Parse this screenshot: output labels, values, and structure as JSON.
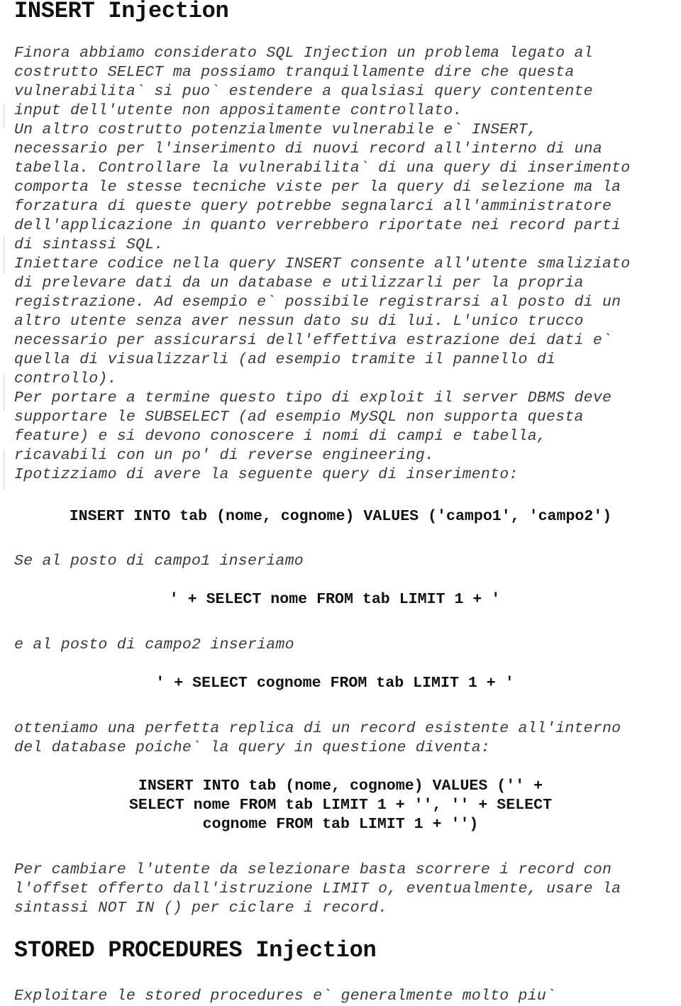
{
  "sections": [
    {
      "heading": "INSERT Injection",
      "paragraph1": [
        "Finora abbiamo considerato SQL Injection un problema legato al",
        "costrutto SELECT ma possiamo tranquillamente dire che questa",
        "vulnerabilita` si puo` estendere a qualsiasi query contentente",
        "input dell'utente non appositamente controllato.",
        "Un altro costrutto potenzialmente vulnerabile e` INSERT,",
        "necessario per l'inserimento di nuovi record all'interno di una",
        "tabella. Controllare la vulnerabilita` di una query di inserimento",
        "comporta le stesse tecniche viste per la query di selezione ma la",
        "forzatura di queste query potrebbe segnalarci all'amministratore",
        "dell'applicazione in quanto verrebbero riportate nei record parti",
        "di sintassi SQL.",
        "Iniettare codice nella query INSERT consente all'utente smaliziato",
        "di prelevare dati da un database e utilizzarli per la propria",
        "registrazione. Ad esempio e` possibile registrarsi al posto di un",
        "altro utente senza aver nessun dato su di lui. L'unico trucco",
        "necessario per assicurarsi dell'effettiva estrazione dei dati e`",
        "quella di visualizzarli (ad esempio tramite il pannello di",
        "controllo).",
        "Per portare a termine questo tipo di exploit il server DBMS deve",
        "supportare le SUBSELECT (ad esempio MySQL non supporta questa",
        "feature) e si devono conoscere i nomi di campi e tabella,",
        "ricavabili con un po' di reverse engineering.",
        "Ipotizziamo di avere la seguente query di inserimento:"
      ],
      "code1": "INSERT INTO tab (nome, cognome) VALUES ('campo1', 'campo2')",
      "text2": "Se al posto di campo1 inseriamo",
      "code2": "' + SELECT nome FROM tab LIMIT 1 + '",
      "text3": "e al posto di campo2 inseriamo",
      "code3": "' + SELECT cognome FROM tab LIMIT 1 + '",
      "paragraph4": [
        "otteniamo una perfetta replica di un record esistente all'interno",
        "del database poiche` la query in questione diventa:"
      ],
      "code4": [
        "INSERT INTO tab (nome, cognome) VALUES ('' +",
        "SELECT nome FROM tab LIMIT 1 + '', '' + SELECT",
        "cognome FROM tab LIMIT 1 + '')"
      ],
      "paragraph5": [
        "Per cambiare l'utente da selezionare basta scorrere i record con",
        "l'offset offerto dall'istruzione LIMIT o, eventualmente, usare la",
        "sintassi NOT IN () per ciclare i record."
      ]
    },
    {
      "heading": "STORED PROCEDURES Injection",
      "paragraph1": [
        "Exploitare le stored procedures e` generalmente molto piu`"
      ]
    }
  ]
}
